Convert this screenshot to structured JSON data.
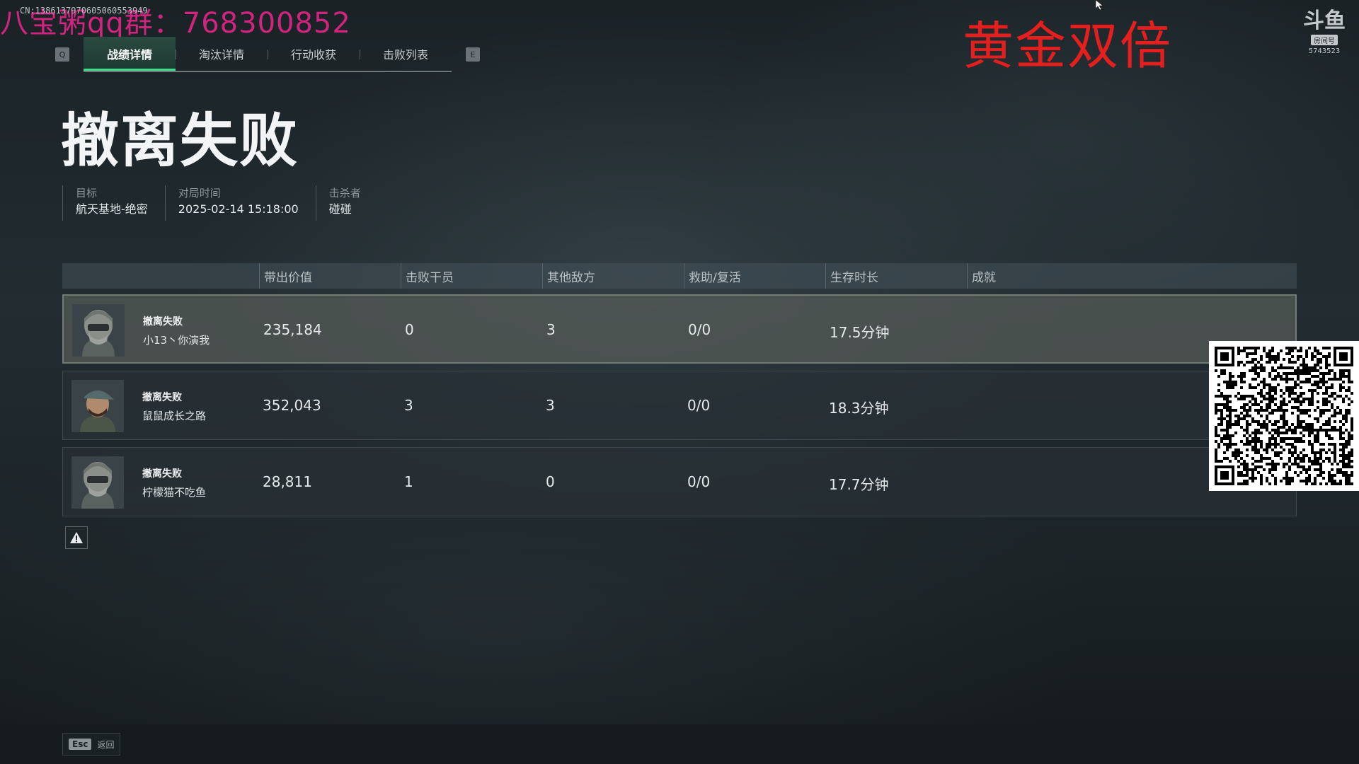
{
  "overlay": {
    "qq_group": "八宝粥qq群：768300852",
    "stream_id": "CN:1386137970605060553949",
    "promo": "黄金双倍",
    "platform_logo": "斗鱼",
    "platform_tag": "房间号",
    "room_number": "5743523"
  },
  "tabs": {
    "prev_key": "Q",
    "next_key": "E",
    "items": [
      {
        "label": "战绩详情",
        "active": true
      },
      {
        "label": "淘汰详情",
        "active": false
      },
      {
        "label": "行动收获",
        "active": false
      },
      {
        "label": "击败列表",
        "active": false
      }
    ]
  },
  "result": {
    "title": "撤离失败",
    "meta": {
      "objective_label": "目标",
      "objective_value": "航天基地-绝密",
      "time_label": "对局时间",
      "time_value": "2025-02-14 15:18:00",
      "killer_label": "击杀者",
      "killer_value": "碰碰"
    }
  },
  "table": {
    "headers": {
      "value": "带出价值",
      "operators": "击败干员",
      "enemies": "其他敌方",
      "assist": "救助/复活",
      "survival": "生存时长",
      "achievements": "成就"
    },
    "rows": [
      {
        "status": "撤离失败",
        "name": "小13丶你演我",
        "value": "235,184",
        "operators": "0",
        "enemies": "3",
        "assist": "0/0",
        "survival": "17.5分钟",
        "selected": true,
        "avatar": "helmet-mask"
      },
      {
        "status": "撤离失败",
        "name": "鼠鼠成长之路",
        "value": "352,043",
        "operators": "3",
        "enemies": "3",
        "assist": "0/0",
        "survival": "18.3分钟",
        "selected": false,
        "avatar": "cap-bearded"
      },
      {
        "status": "撤离失败",
        "name": "柠檬猫不吃鱼",
        "value": "28,811",
        "operators": "1",
        "enemies": "0",
        "assist": "0/0",
        "survival": "17.7分钟",
        "selected": false,
        "avatar": "helmet-mask"
      }
    ]
  },
  "footer": {
    "esc_key": "Esc",
    "esc_label": "返回"
  },
  "colors": {
    "accent": "#3fdc8a",
    "watermark_pink": "#d0247f",
    "promo_red": "#e51e1e"
  }
}
